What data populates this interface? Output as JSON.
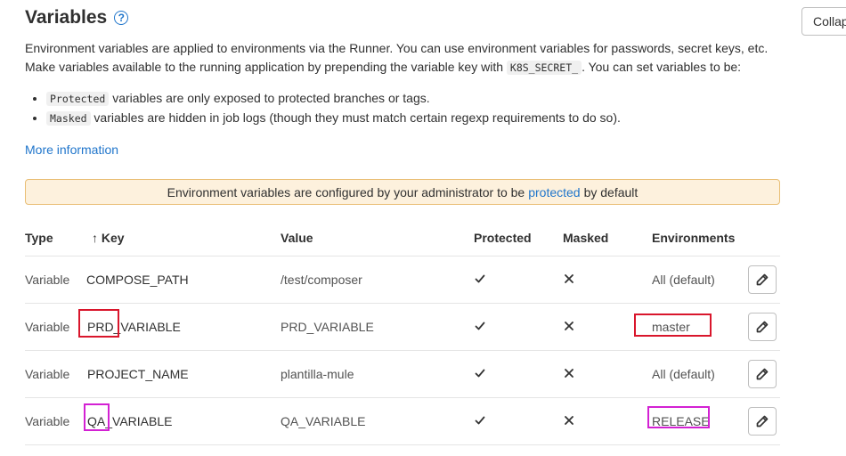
{
  "page": {
    "title": "Variables",
    "collapse_label": "Collapse",
    "description": {
      "line1": "Environment variables are applied to environments via the Runner. You can use environment variables for passwords, secret keys, etc.",
      "line2_pre": "Make variables available to the running application by prepending the variable key with",
      "line2_code": "K8S_SECRET_",
      "line2_post": ". You can set variables to be:"
    },
    "bullets": [
      {
        "code": "Protected",
        "text": " variables are only exposed to protected branches or tags."
      },
      {
        "code": "Masked",
        "text": " variables are hidden in job logs (though they must match certain regexp requirements to do so)."
      }
    ],
    "more_info_link": "More information",
    "alert": {
      "pre": "Environment variables are configured by your administrator to be",
      "link": "protected",
      "post": "by default"
    }
  },
  "table": {
    "headers": {
      "type": "Type",
      "key": "↑ Key",
      "value": "Value",
      "protected": "Protected",
      "masked": "Masked",
      "environments": "Environments"
    },
    "rows": [
      {
        "type": "Variable",
        "key": "COMPOSE_PATH",
        "value": "/test/composer",
        "protected": true,
        "masked": false,
        "environment": "All (default)"
      },
      {
        "type": "Variable",
        "key": "PRD_VARIABLE",
        "value": "PRD_VARIABLE",
        "protected": true,
        "masked": false,
        "environment": "master"
      },
      {
        "type": "Variable",
        "key": "PROJECT_NAME",
        "value": "plantilla-mule",
        "protected": true,
        "masked": false,
        "environment": "All (default)"
      },
      {
        "type": "Variable",
        "key": "QA_VARIABLE",
        "value": "QA_VARIABLE",
        "protected": true,
        "masked": false,
        "environment": "RELEASE"
      }
    ]
  },
  "annotations": {
    "red_color": "#d9162c",
    "magenta_color": "#d321d3"
  },
  "icons": {
    "help": "question-circle-icon",
    "check": "check-icon",
    "close": "close-icon",
    "edit": "pencil-icon"
  },
  "colors": {
    "link": "#1f75cb",
    "alert_bg": "#fdf1dd",
    "alert_border": "#e9be74"
  }
}
